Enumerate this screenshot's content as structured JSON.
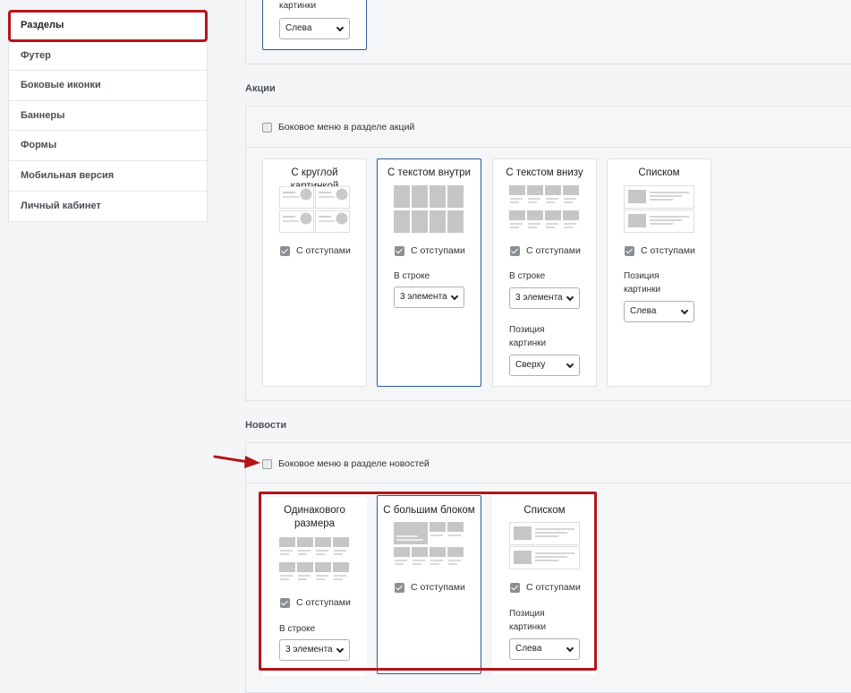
{
  "sidebar": {
    "items": [
      {
        "label": "Разделы"
      },
      {
        "label": "Футер"
      },
      {
        "label": "Боковые иконки"
      },
      {
        "label": "Баннеры"
      },
      {
        "label": "Формы"
      },
      {
        "label": "Мобильная версия"
      },
      {
        "label": "Личный кабинет"
      }
    ]
  },
  "top_card": {
    "label": "картинки",
    "select_value": "Слева"
  },
  "promo": {
    "title": "Акции",
    "side_menu_label": "Боковое меню в разделе акций",
    "side_menu_checked": false,
    "cards": [
      {
        "title": "С круглой картинкой",
        "padding_label": "С отступами",
        "padding_checked": true
      },
      {
        "title": "С текстом внутри",
        "padding_label": "С отступами",
        "padding_checked": true,
        "row_label": "В строке",
        "row_value": "3 элемента",
        "selected": true
      },
      {
        "title": "С текстом внизу",
        "padding_label": "С отступами",
        "padding_checked": true,
        "row_label": "В строке",
        "row_value": "3 элемента",
        "pos_label": "Позиция картинки",
        "pos_value": "Сверху"
      },
      {
        "title": "Списком",
        "padding_label": "С отступами",
        "padding_checked": true,
        "pos_label": "Позиция картинки",
        "pos_value": "Слева"
      }
    ]
  },
  "news": {
    "title": "Новости",
    "side_menu_label": "Боковое меню в разделе новостей",
    "side_menu_checked": false,
    "cards": [
      {
        "title": "Одинакового размера",
        "padding_label": "С отступами",
        "padding_checked": true,
        "row_label": "В строке",
        "row_value": "3 элемента"
      },
      {
        "title": "С большим блоком",
        "padding_label": "С отступами",
        "padding_checked": true,
        "selected": true
      },
      {
        "title": "Списком",
        "padding_label": "С отступами",
        "padding_checked": true,
        "pos_label": "Позиция картинки",
        "pos_value": "Слева"
      }
    ]
  },
  "colors": {
    "highlight": "#b3151b",
    "selected_border": "#2c5a96"
  }
}
